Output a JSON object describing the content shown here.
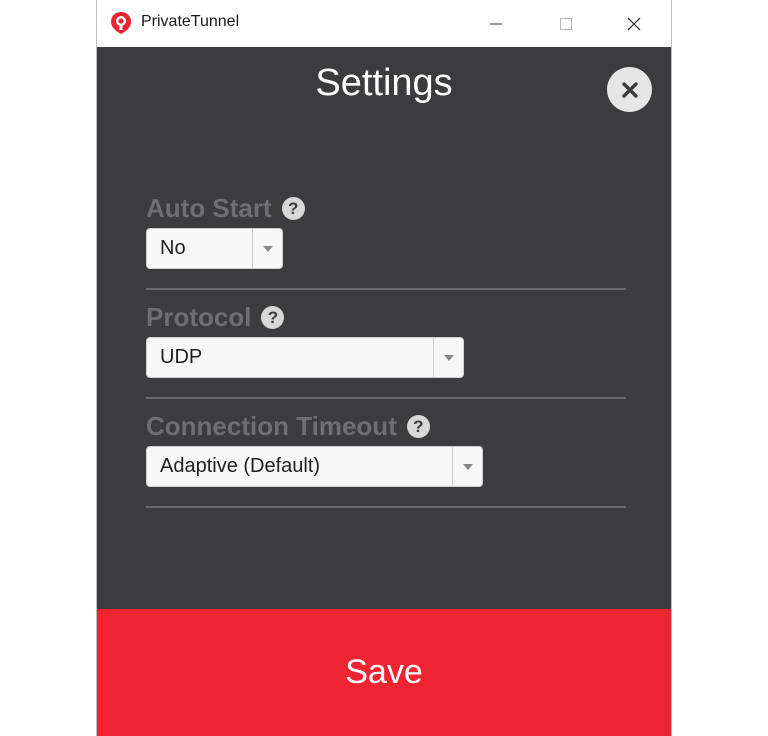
{
  "window": {
    "title": "PrivateTunnel",
    "brand_color": "#ee2430"
  },
  "titlebar": {
    "minimize_icon": "minimize-icon",
    "maximize_icon": "maximize-icon",
    "close_icon": "close-icon"
  },
  "settings": {
    "heading": "Settings",
    "close_icon": "close-circle-icon",
    "fields": [
      {
        "label": "Auto Start",
        "value": "No",
        "help_icon": "help-icon"
      },
      {
        "label": "Protocol",
        "value": "UDP",
        "help_icon": "help-icon"
      },
      {
        "label": "Connection Timeout",
        "value": "Adaptive (Default)",
        "help_icon": "help-icon"
      }
    ]
  },
  "footer": {
    "save_label": "Save"
  }
}
